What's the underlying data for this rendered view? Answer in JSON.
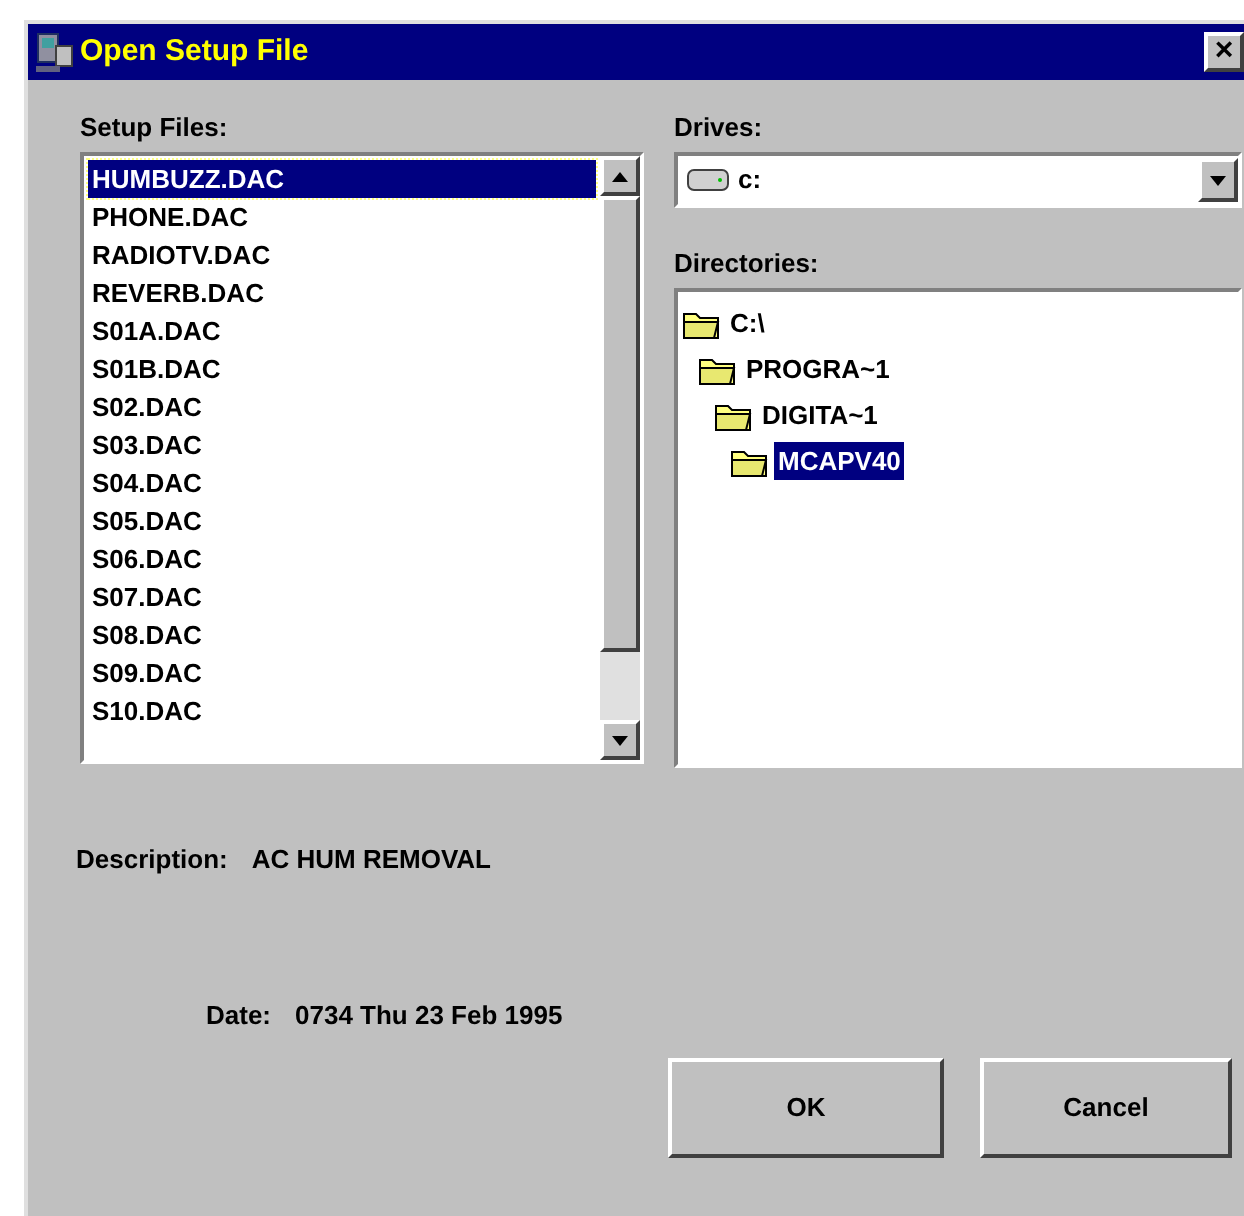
{
  "window": {
    "title": "Open Setup File",
    "close": "×"
  },
  "setup_files": {
    "label": "Setup Files:",
    "items": [
      {
        "name": "HUMBUZZ.DAC",
        "selected": true
      },
      {
        "name": "PHONE.DAC",
        "selected": false
      },
      {
        "name": "RADIOTV.DAC",
        "selected": false
      },
      {
        "name": "REVERB.DAC",
        "selected": false
      },
      {
        "name": "S01A.DAC",
        "selected": false
      },
      {
        "name": "S01B.DAC",
        "selected": false
      },
      {
        "name": "S02.DAC",
        "selected": false
      },
      {
        "name": "S03.DAC",
        "selected": false
      },
      {
        "name": "S04.DAC",
        "selected": false
      },
      {
        "name": "S05.DAC",
        "selected": false
      },
      {
        "name": "S06.DAC",
        "selected": false
      },
      {
        "name": "S07.DAC",
        "selected": false
      },
      {
        "name": "S08.DAC",
        "selected": false
      },
      {
        "name": "S09.DAC",
        "selected": false
      },
      {
        "name": "S10.DAC",
        "selected": false
      }
    ]
  },
  "drives": {
    "label": "Drives:",
    "value": "c:"
  },
  "directories": {
    "label": "Directories:",
    "tree": [
      {
        "name": "C:\\",
        "selected": false,
        "children": [
          {
            "name": "PROGRA~1",
            "selected": false,
            "children": [
              {
                "name": "DIGITA~1",
                "selected": false,
                "children": [
                  {
                    "name": "MCAPV40",
                    "selected": true
                  }
                ]
              }
            ]
          }
        ]
      }
    ]
  },
  "description": {
    "label": "Description:",
    "value": "AC HUM REMOVAL"
  },
  "date": {
    "label": "Date:",
    "value": "0734 Thu 23 Feb 1995"
  },
  "buttons": [
    "OK",
    "Cancel"
  ]
}
